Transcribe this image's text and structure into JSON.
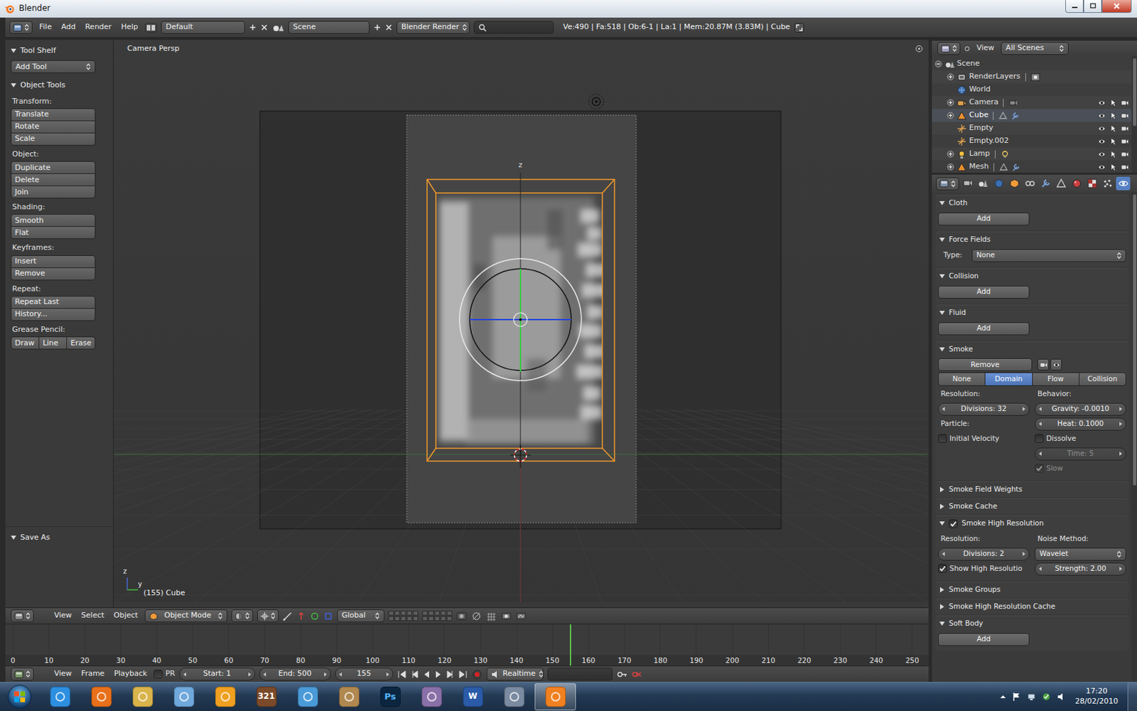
{
  "window": {
    "title": "Blender"
  },
  "header": {
    "menus": [
      "File",
      "Add",
      "Render",
      "Help"
    ],
    "layout": "Default",
    "scene": "Scene",
    "engine": "Blender Render",
    "stats": "Ve:490 | Fa:518 | Ob:6-1 | La:1 | Mem:20.87M (3.83M) | Cube"
  },
  "tool_shelf": {
    "header": {
      "title": "Tool Shelf",
      "expanded": true
    },
    "add_tool": "Add Tool",
    "object_tools": {
      "title": "Object Tools",
      "expanded": true,
      "groups": [
        {
          "label": "Transform:",
          "buttons": [
            "Translate",
            "Rotate",
            "Scale"
          ]
        },
        {
          "label": "Object:",
          "buttons": [
            "Duplicate",
            "Delete",
            "Join"
          ]
        },
        {
          "label": "Shading:",
          "buttons": [
            "Smooth",
            "Flat"
          ]
        },
        {
          "label": "Keyframes:",
          "buttons": [
            "Insert",
            "Remove"
          ]
        },
        {
          "label": "Repeat:",
          "buttons": [
            "Repeat Last",
            "History..."
          ]
        }
      ],
      "grease_pencil": {
        "label": "Grease Pencil:",
        "buttons": [
          "Draw",
          "Line",
          "Erase"
        ]
      }
    },
    "save_as": {
      "title": "Save As",
      "expanded": true
    }
  },
  "viewport": {
    "view_name": "Camera Persp",
    "object_info": "(155) Cube",
    "axis_label": "z",
    "mini_axes": [
      "z",
      "y"
    ]
  },
  "viewport_header": {
    "menus": [
      "View",
      "Select",
      "Object"
    ],
    "mode": "Object Mode",
    "orientation": "Global"
  },
  "timeline": {
    "ticks": [
      "0",
      "10",
      "20",
      "30",
      "40",
      "50",
      "60",
      "70",
      "80",
      "90",
      "100",
      "110",
      "120",
      "130",
      "140",
      "150",
      "160",
      "170",
      "180",
      "190",
      "200",
      "210",
      "220",
      "230",
      "240",
      "250"
    ],
    "playhead_level": 0.62
  },
  "timeline_header": {
    "menus": [
      "View",
      "Frame",
      "Playback"
    ],
    "pr": {
      "label": "PR",
      "checked": false
    },
    "start": "Start: 1",
    "end": "End: 500",
    "current_frame": "155",
    "sync": "Realtime"
  },
  "outliner": {
    "menu": "View",
    "filter": "All Scenes",
    "items": [
      {
        "label": "Scene",
        "depth": 0,
        "kind": "scene",
        "expandable": true,
        "expanded": true,
        "selected": false
      },
      {
        "label": "RenderLayers",
        "depth": 1,
        "kind": "renderlayers",
        "expandable": true,
        "expanded": false,
        "selected": false
      },
      {
        "label": "World",
        "depth": 1,
        "kind": "world",
        "expandable": false,
        "selected": false
      },
      {
        "label": "Camera",
        "depth": 1,
        "kind": "camera",
        "expandable": true,
        "expanded": false,
        "selected": false
      },
      {
        "label": "Cube",
        "depth": 1,
        "kind": "mesh",
        "expandable": true,
        "expanded": false,
        "selected": true
      },
      {
        "label": "Empty",
        "depth": 1,
        "kind": "empty",
        "expandable": false,
        "selected": false
      },
      {
        "label": "Empty.002",
        "depth": 1,
        "kind": "empty",
        "expandable": false,
        "selected": false
      },
      {
        "label": "Lamp",
        "depth": 1,
        "kind": "lamp",
        "expandable": true,
        "expanded": false,
        "selected": false
      },
      {
        "label": "Mesh",
        "depth": 1,
        "kind": "mesh",
        "expandable": true,
        "expanded": false,
        "selected": false
      }
    ]
  },
  "properties": {
    "context_tabs": [
      {
        "selected": false
      },
      {
        "selected": false
      },
      {
        "selected": false
      },
      {
        "selected": false
      },
      {
        "selected": false
      },
      {
        "selected": false
      },
      {
        "selected": false
      },
      {
        "selected": false
      },
      {
        "selected": false
      },
      {
        "selected": false
      },
      {
        "selected": true
      }
    ],
    "panels": [
      {
        "title": "Cloth",
        "expanded": true,
        "rows": [
          {
            "kind": "button",
            "label": "Add"
          }
        ]
      },
      {
        "title": "Force Fields",
        "expanded": true,
        "rows": [
          {
            "kind": "dropdown",
            "label": "Type:",
            "value": "None"
          }
        ]
      },
      {
        "title": "Collision",
        "expanded": true,
        "rows": [
          {
            "kind": "button",
            "label": "Add"
          }
        ]
      },
      {
        "title": "Fluid",
        "expanded": true,
        "rows": [
          {
            "kind": "button",
            "label": "Add"
          }
        ]
      },
      {
        "title": "Smoke",
        "expanded": true,
        "rows": [
          {
            "kind": "button_icons",
            "label": "Remove"
          },
          {
            "kind": "tabs",
            "items": [
              {
                "label": "None",
                "selected": false
              },
              {
                "label": "Domain",
                "selected": true
              },
              {
                "label": "Flow",
                "selected": false
              },
              {
                "label": "Collision",
                "selected": false
              }
            ]
          },
          {
            "kind": "pair",
            "cells": [
              {
                "kind": "label",
                "text": "Resolution:"
              },
              {
                "kind": "label",
                "text": "Behavior:"
              }
            ]
          },
          {
            "kind": "pair",
            "cells": [
              {
                "kind": "number",
                "text": "Divisions: 32",
                "disabled": false
              },
              {
                "kind": "number",
                "text": "Gravity: -0.0010",
                "disabled": false
              }
            ]
          },
          {
            "kind": "pair",
            "cells": [
              {
                "kind": "label",
                "text": "Particle:"
              },
              {
                "kind": "number",
                "text": "Heat: 0.1000",
                "disabled": false
              }
            ]
          },
          {
            "kind": "pair",
            "cells": [
              {
                "kind": "check",
                "text": "Initial Velocity",
                "checked": false,
                "disabled": false
              },
              {
                "kind": "check",
                "text": "Dissolve",
                "checked": false,
                "disabled": false
              }
            ]
          },
          {
            "kind": "pair",
            "cells": [
              {
                "kind": "empty"
              },
              {
                "kind": "number",
                "text": "Time: 5",
                "disabled": true
              }
            ]
          },
          {
            "kind": "pair",
            "cells": [
              {
                "kind": "empty"
              },
              {
                "kind": "check",
                "text": "Slow",
                "checked": true,
                "disabled": true
              }
            ]
          }
        ]
      },
      {
        "title": "Smoke Field Weights",
        "expanded": false
      },
      {
        "title": "Smoke Cache",
        "expanded": false
      },
      {
        "title": "Smoke High Resolution",
        "expanded": true,
        "checked": true,
        "rows": [
          {
            "kind": "pair",
            "cells": [
              {
                "kind": "label",
                "text": "Resolution:"
              },
              {
                "kind": "label",
                "text": "Noise Method:"
              }
            ]
          },
          {
            "kind": "pair",
            "cells": [
              {
                "kind": "number",
                "text": "Divisions: 2",
                "disabled": false
              },
              {
                "kind": "dropdown",
                "text": "Wavelet"
              }
            ]
          },
          {
            "kind": "pair",
            "cells": [
              {
                "kind": "check",
                "text": "Show High Resolutio",
                "checked": true,
                "disabled": false
              },
              {
                "kind": "number",
                "text": "Strength: 2.00",
                "disabled": false
              }
            ]
          }
        ]
      },
      {
        "title": "Smoke Groups",
        "expanded": false
      },
      {
        "title": "Smoke High Resolution Cache",
        "expanded": false
      },
      {
        "title": "Soft Body",
        "expanded": true,
        "rows": [
          {
            "kind": "button",
            "label": "Add"
          }
        ]
      }
    ]
  },
  "taskbar": {
    "apps": [
      {
        "kind": "plain",
        "color": "#2d8fe0",
        "selected": false
      },
      {
        "kind": "plain",
        "color": "#e8701a",
        "selected": false
      },
      {
        "kind": "plain",
        "color": "#d9b44a",
        "selected": false
      },
      {
        "kind": "plain",
        "color": "#6fa8dc",
        "selected": false
      },
      {
        "kind": "plain",
        "color": "#f0a020",
        "selected": false
      },
      {
        "kind": "lettered",
        "glyph": "321",
        "color": "#7a4a2a",
        "selected": false
      },
      {
        "kind": "plain",
        "color": "#4a9ad8",
        "selected": false
      },
      {
        "kind": "plain",
        "color": "#b08850",
        "selected": false
      },
      {
        "kind": "lettered",
        "glyph": "Ps",
        "color": "#0c2640",
        "selected": false
      },
      {
        "kind": "plain",
        "color": "#8a70a8",
        "selected": false
      },
      {
        "kind": "lettered",
        "glyph": "W",
        "color": "#2a5aa8",
        "selected": false
      },
      {
        "kind": "plain",
        "color": "#7a8aa0",
        "selected": false
      },
      {
        "kind": "plain",
        "color": "#f08020",
        "selected": true
      }
    ],
    "time": "17:20",
    "date": "28/02/2010"
  }
}
